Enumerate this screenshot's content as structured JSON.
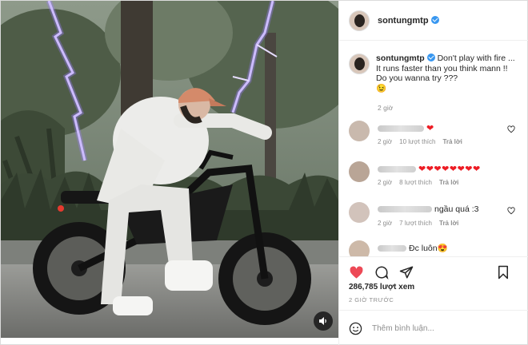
{
  "header": {
    "username": "sontungmtp",
    "verified": true
  },
  "caption": {
    "username": "sontungmtp",
    "line1": "Don't play with fire ...",
    "line2": "It runs faster than you think mann !!",
    "line3": "Do you wanna try ???",
    "emoji": "😉",
    "time": "2 giờ"
  },
  "comments": [
    {
      "text": "❤",
      "time": "2 giờ",
      "likes": "10 lượt thích",
      "reply": "Trả lời"
    },
    {
      "text": "❤❤❤❤❤❤❤❤",
      "time": "2 giờ",
      "likes": "8 lượt thích",
      "reply": "Trả lời"
    },
    {
      "text": "ngầu quá :3",
      "time": "2 giờ",
      "likes": "7 lượt thích",
      "reply": "Trả lời"
    },
    {
      "text": "Đc luôn😍",
      "time": "",
      "likes": "",
      "reply": ""
    }
  ],
  "stats": {
    "views": "286,785 lượt xem",
    "posted_ago": "2 GIỜ TRƯỚC"
  },
  "add_comment": {
    "placeholder": "Thêm bình luận..."
  },
  "icons": {
    "like": "heart-filled-icon",
    "comment": "comment-bubble-icon",
    "share": "paper-plane-icon",
    "save": "bookmark-icon",
    "emoji": "smiley-icon",
    "mute": "speaker-icon"
  },
  "colors": {
    "like": "#ed4956",
    "verified": "#3897f0",
    "muted_text": "#8e8e8e"
  }
}
